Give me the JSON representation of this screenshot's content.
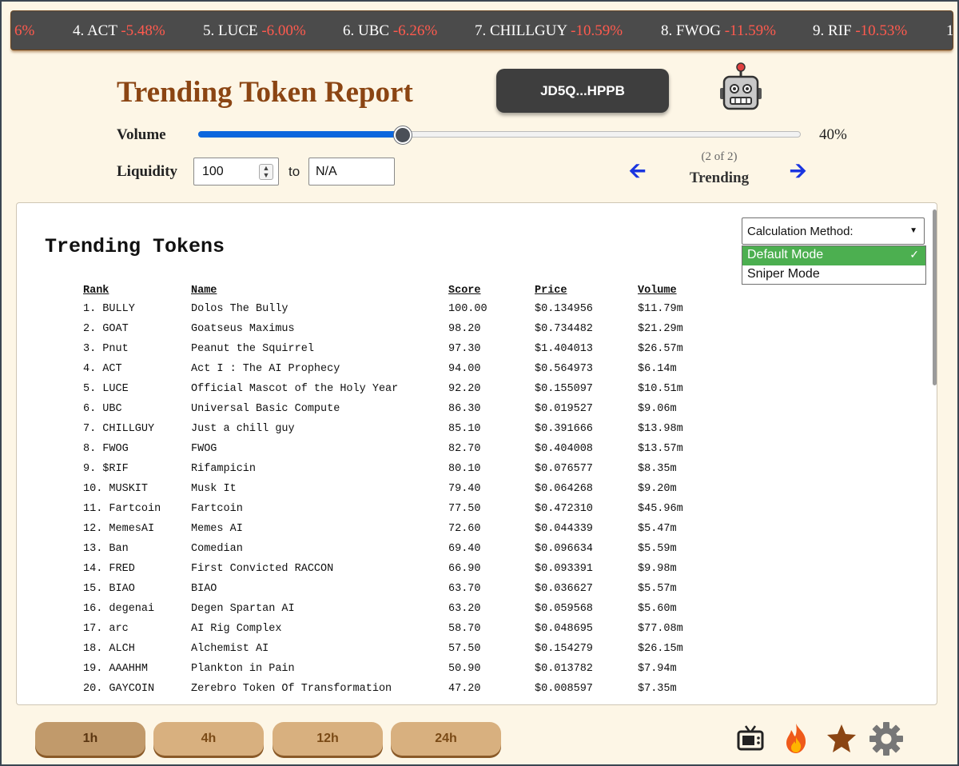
{
  "ticker": [
    {
      "label": "",
      "change": "6%"
    },
    {
      "label": "4. ACT",
      "change": "-5.48%"
    },
    {
      "label": "5. LUCE",
      "change": "-6.00%"
    },
    {
      "label": "6. UBC",
      "change": "-6.26%"
    },
    {
      "label": "7. CHILLGUY",
      "change": "-10.59%"
    },
    {
      "label": "8. FWOG",
      "change": "-11.59%"
    },
    {
      "label": "9. RIF",
      "change": "-10.53%"
    },
    {
      "label": "1",
      "change": ""
    }
  ],
  "header": {
    "title": "Trending Token Report",
    "wallet": "JD5Q...HPPB",
    "robot_icon": "robot-icon"
  },
  "filters": {
    "volume_label": "Volume",
    "volume_percent": "40%",
    "volume_fraction": 0.34,
    "liquidity_label": "Liquidity",
    "liquidity_min": "100",
    "to_label": "to",
    "liquidity_max": "N/A"
  },
  "pager": {
    "indicator": "(2 of 2)",
    "name": "Trending"
  },
  "panel": {
    "title": "Trending Tokens",
    "columns": [
      "Rank",
      "Name",
      "Score",
      "Price",
      "Volume"
    ],
    "rows": [
      [
        "1. BULLY",
        "Dolos The Bully",
        "100.00",
        "$0.134956",
        "$11.79m"
      ],
      [
        "2. GOAT",
        "Goatseus Maximus",
        "98.20",
        "$0.734482",
        "$21.29m"
      ],
      [
        "3. Pnut",
        "Peanut the Squirrel",
        "97.30",
        "$1.404013",
        "$26.57m"
      ],
      [
        "4. ACT",
        "Act I : The AI Prophecy",
        "94.00",
        "$0.564973",
        "$6.14m"
      ],
      [
        "5. LUCE",
        "Official Mascot of the Holy Year",
        "92.20",
        "$0.155097",
        "$10.51m"
      ],
      [
        "6. UBC",
        "Universal Basic Compute",
        "86.30",
        "$0.019527",
        "$9.06m"
      ],
      [
        "7. CHILLGUY",
        "Just a chill guy",
        "85.10",
        "$0.391666",
        "$13.98m"
      ],
      [
        "8. FWOG",
        "FWOG",
        "82.70",
        "$0.404008",
        "$13.57m"
      ],
      [
        "9. $RIF",
        "Rifampicin",
        "80.10",
        "$0.076577",
        "$8.35m"
      ],
      [
        "10. MUSKIT",
        "Musk It",
        "79.40",
        "$0.064268",
        "$9.20m"
      ],
      [
        "11. Fartcoin",
        "Fartcoin",
        "77.50",
        "$0.472310",
        "$45.96m"
      ],
      [
        "12. MemesAI",
        "Memes AI",
        "72.60",
        "$0.044339",
        "$5.47m"
      ],
      [
        "13. Ban",
        "Comedian",
        "69.40",
        "$0.096634",
        "$5.59m"
      ],
      [
        "14. FRED",
        "First Convicted RACCON",
        "66.90",
        "$0.093391",
        "$9.98m"
      ],
      [
        "15. BIAO",
        "BIAO",
        "63.70",
        "$0.036627",
        "$5.57m"
      ],
      [
        "16. degenai",
        "Degen Spartan AI",
        "63.20",
        "$0.059568",
        "$5.60m"
      ],
      [
        "17. arc",
        "AI Rig Complex",
        "58.70",
        "$0.048695",
        "$77.08m"
      ],
      [
        "18. ALCH",
        "Alchemist AI",
        "57.50",
        "$0.154279",
        "$26.15m"
      ],
      [
        "19. AAAHHM",
        "Plankton in Pain",
        "50.90",
        "$0.013782",
        "$7.94m"
      ],
      [
        "20. GAYCOIN",
        "Zerebro Token Of Transformation",
        "47.20",
        "$0.008597",
        "$7.35m"
      ]
    ]
  },
  "calc_method": {
    "label": "Calculation Method:",
    "options": [
      "Default Mode",
      "Sniper Mode"
    ],
    "selected": "Default Mode",
    "check": "✓"
  },
  "timeframes": [
    "1h",
    "4h",
    "12h",
    "24h"
  ],
  "active_timeframe": "1h",
  "bottom_icons": [
    "tv-icon",
    "fire-icon",
    "star-icon",
    "gear-icon"
  ],
  "colors": {
    "title": "#8b4513",
    "ticker_change": "#ff5a4e",
    "slider_fill": "#0b67dd",
    "selected_option": "#4caf50",
    "button": "#d8b07f"
  }
}
